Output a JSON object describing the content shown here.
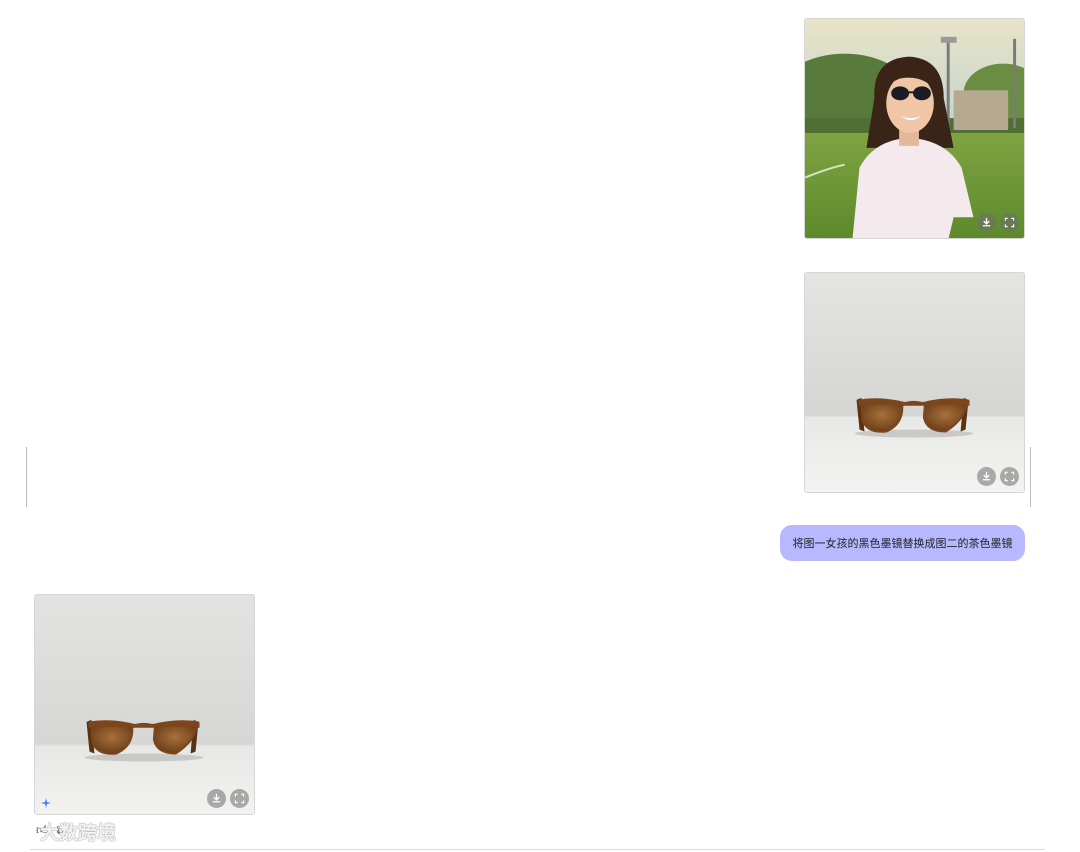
{
  "messages": {
    "user_image_1": {
      "alt": "girl-with-black-sunglasses"
    },
    "user_image_2": {
      "alt": "brown-tea-sunglasses"
    },
    "user_prompt": "将图一女孩的黑色墨镜替换成图二的茶色墨镜",
    "result_image": {
      "alt": "brown-tea-sunglasses-result"
    }
  },
  "actions": {
    "download_icon": "download-icon",
    "expand_icon": "fullscreen-icon",
    "like_icon": "thumbs-up-icon",
    "copy_icon": "copy-icon"
  },
  "watermark": {
    "text": "大数跨境"
  },
  "colors": {
    "bubble": "#b7b8ff",
    "accent": "#4a7dff"
  }
}
